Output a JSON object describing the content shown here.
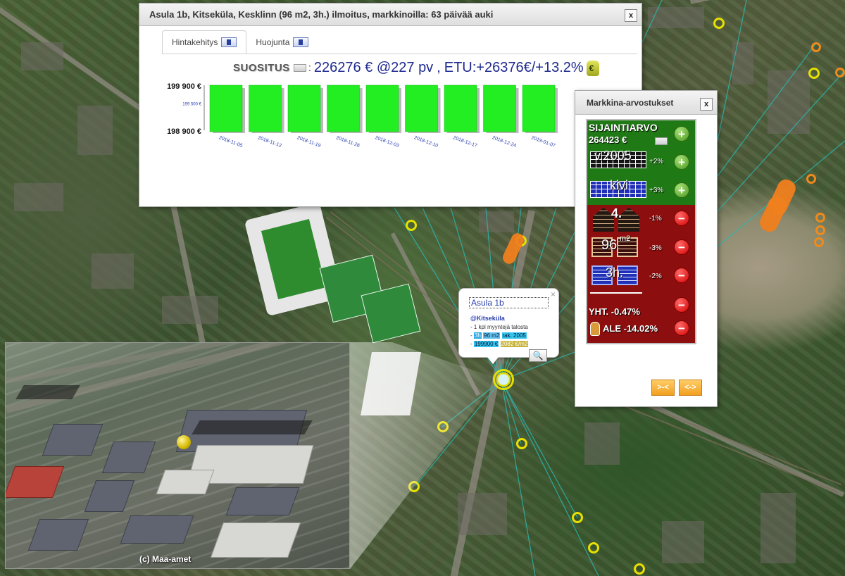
{
  "main_panel": {
    "title": "Asula 1b, Kitseküla, Kesklinn (96 m2, 3h.) ilmoitus, markkinoilla: 63 päivää auki",
    "close_label": "x",
    "tabs": [
      {
        "label": "Hintakehitys",
        "active": true
      },
      {
        "label": "Huojunta",
        "active": false
      }
    ],
    "recommendation": {
      "label": "SUOSITUS",
      "colon": ":",
      "value": "226276 € @227 pv",
      "separator": ",",
      "gain": "ETU:+26376€/+13.2%"
    }
  },
  "chart_data": {
    "type": "bar",
    "categories": [
      "2018-11-05",
      "2018-11-12",
      "2018-11-19",
      "2018-11-26",
      "2018-12-03",
      "2018-12-10",
      "2018-12-17",
      "2018-12-24",
      "2019-01-07"
    ],
    "values": [
      199900,
      199900,
      199900,
      199900,
      199900,
      199900,
      199900,
      199900,
      199900
    ],
    "ytick_labels": [
      "199 900 €",
      "199 500 €",
      "198 900 €"
    ],
    "ytick_values": [
      199900,
      199500,
      198900
    ],
    "ylim": [
      198900,
      199900
    ],
    "bar_color": "#22ee22"
  },
  "popup": {
    "close_label": "×",
    "title": "Asula 1b",
    "area": "@Kitseküla",
    "sold": "- 1 kpl myyntejä talosta",
    "row2_prefix": "- ",
    "row2_rooms": "3h",
    "row2_size": "96 m2",
    "row2_year": "rak. 2005",
    "row3_prefix": "- ",
    "row3_price": "199900 €",
    "row3_sqm": "2082 €/m2",
    "zoom_icon": "🔍"
  },
  "market_panel": {
    "title": "Markkina-arvostukset",
    "close_label": "x",
    "location_label": "SIJAINTIARVO",
    "location_value": "264423 €",
    "year_label": "v.2005",
    "year_pct": "+2%",
    "material_label": "kivi",
    "material_pct": "+3%",
    "floor_label": "4.",
    "floor_pct": "-1%",
    "size_label": "96",
    "size_unit": "m2",
    "size_pct": "-3%",
    "rooms_label": "3h.",
    "rooms_pct": "-2%",
    "total_label": "YHT. -0.47%",
    "discount_label": "ALE -14.02%",
    "plus_label": "+",
    "minus_label": "−",
    "btn_shrink": ">-<",
    "btn_expand": "<->"
  },
  "map": {
    "credit": "(c) Maa-amet"
  },
  "icons": {
    "tab_icon": "map-zoom-icon",
    "money_icon": "money-bag-icon",
    "marker_icon": "database-icon",
    "hand_icon": "hand-icon"
  }
}
